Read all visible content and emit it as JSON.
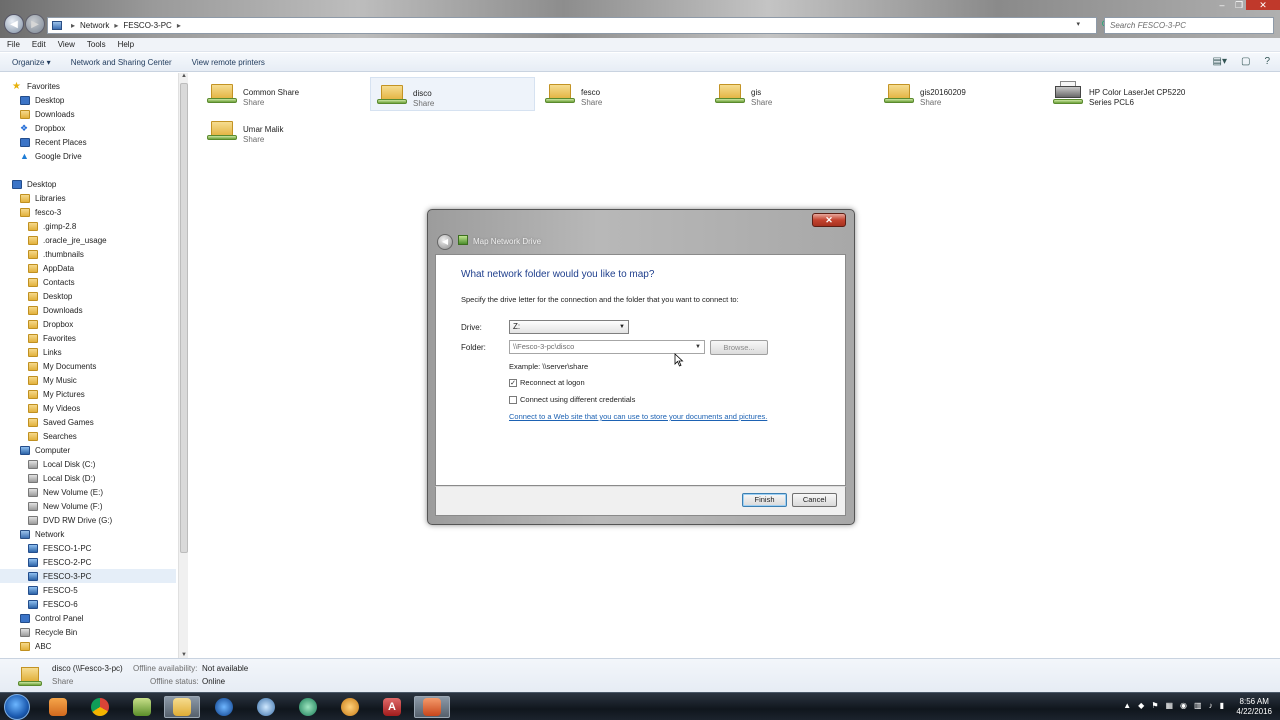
{
  "explorer": {
    "address": {
      "crumbs": [
        "Network",
        "FESCO-3-PC"
      ]
    },
    "search_placeholder": "Search FESCO-3-PC",
    "menu": [
      "File",
      "Edit",
      "View",
      "Tools",
      "Help"
    ],
    "toolbar": {
      "organize": "Organize ▾",
      "network_sharing": "Network and Sharing Center",
      "view_printers": "View remote printers"
    },
    "nav": {
      "favorites": "Favorites",
      "fav_items": [
        "Desktop",
        "Downloads",
        "Dropbox",
        "Recent Places",
        "Google Drive"
      ],
      "desktop": "Desktop",
      "libraries": "Libraries",
      "user": "fesco-3",
      "user_items": [
        ".gimp-2.8",
        ".oracle_jre_usage",
        ".thumbnails",
        "AppData",
        "Contacts",
        "Desktop",
        "Downloads",
        "Dropbox",
        "Favorites",
        "Links",
        "My Documents",
        "My Music",
        "My Pictures",
        "My Videos",
        "Saved Games",
        "Searches"
      ],
      "computer": "Computer",
      "drives": [
        "Local Disk (C:)",
        "Local Disk (D:)",
        "New Volume (E:)",
        "New Volume (F:)",
        "DVD RW Drive (G:)"
      ],
      "network": "Network",
      "pcs": [
        "FESCO-1-PC",
        "FESCO-2-PC",
        "FESCO-3-PC",
        "FESCO-5",
        "FESCO-6"
      ],
      "control_panel": "Control Panel",
      "recycle_bin": "Recycle Bin",
      "abc": "ABC"
    },
    "shares": [
      {
        "name": "Common Share",
        "type": "Share"
      },
      {
        "name": "disco",
        "type": "Share"
      },
      {
        "name": "fesco",
        "type": "Share"
      },
      {
        "name": "gis",
        "type": "Share"
      },
      {
        "name": "gis20160209",
        "type": "Share"
      },
      {
        "name": "HP Color LaserJet CP5220 Series PCL6",
        "type": ""
      },
      {
        "name": "Umar Malik",
        "type": "Share"
      }
    ],
    "details": {
      "name": "disco (\\\\Fesco-3-pc)",
      "type": "Share",
      "avail_label": "Offline availability:",
      "avail_value": "Not available",
      "status_label": "Offline status:",
      "status_value": "Online"
    }
  },
  "dialog": {
    "title": "Map Network Drive",
    "heading": "What network folder would you like to map?",
    "instruction": "Specify the drive letter for the connection and the folder that you want to connect to:",
    "drive_label": "Drive:",
    "drive_value": "Z:",
    "folder_label": "Folder:",
    "folder_value": "\\\\Fesco-3-pc\\disco",
    "browse": "Browse...",
    "example": "Example: \\\\server\\share",
    "reconnect": "Reconnect at logon",
    "reconnect_checked": true,
    "diff_creds": "Connect using different credentials",
    "diff_creds_checked": false,
    "link": "Connect to a Web site that you can use to store your documents and pictures.",
    "finish": "Finish",
    "cancel": "Cancel"
  },
  "taskbar": {
    "time": "8:56 AM",
    "date": "4/22/2016"
  }
}
